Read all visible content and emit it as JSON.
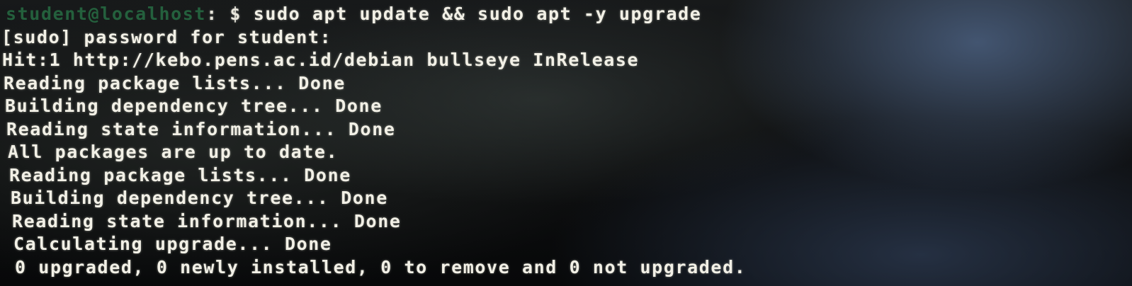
{
  "terminal": {
    "prompt": {
      "user_host": "student@localhost",
      "separator": ": $ ",
      "command": "sudo apt update && sudo apt -y upgrade"
    },
    "lines": [
      "[sudo] password for student:",
      "Hit:1 http://kebo.pens.ac.id/debian bullseye InRelease",
      "Reading package lists... Done",
      "Building dependency tree... Done",
      "Reading state information... Done",
      "All packages are up to date.",
      "Reading package lists... Done",
      "Building dependency tree... Done",
      "Reading state information... Done",
      "Calculating upgrade... Done",
      "0 upgraded, 0 newly installed, 0 to remove and 0 not upgraded."
    ]
  },
  "colors": {
    "text": "#f2f0e6",
    "prompt_host": "#2f9a5a",
    "background": "#0d0e0f"
  }
}
